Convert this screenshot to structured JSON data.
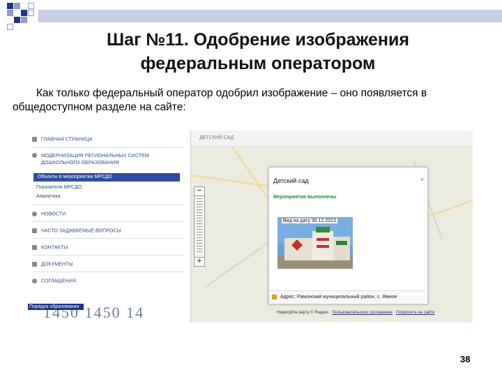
{
  "slide": {
    "title_line1": "Шаг №11. Одобрение изображения",
    "title_line2": "федеральным оператором",
    "intro": "Как только федеральный оператор одобрил изображение – оно появляется в общедоступном разделе на сайте:",
    "page_number": "38"
  },
  "screenshot": {
    "sidebar": {
      "items": [
        {
          "label": "Главная страница",
          "icon": "home-icon"
        },
        {
          "label": "Модернизация региональных систем дошкольного образования",
          "icon": "dot-icon"
        },
        {
          "label": "Новости",
          "icon": "dot-icon"
        },
        {
          "label": "Часто задаваемые вопросы",
          "icon": "chat-icon"
        },
        {
          "label": "Контакты",
          "icon": "phone-icon"
        },
        {
          "label": "Документы",
          "icon": "docs-icon"
        },
        {
          "label": "Соглашения",
          "icon": "dot-icon"
        }
      ],
      "subitems": [
        {
          "label": "Объекты в мероприятии МРСДО",
          "active": true
        },
        {
          "label": "Показатели МРСДО",
          "active": false
        },
        {
          "label": "Аналитика",
          "active": false
        }
      ],
      "bottom_link": "Порядок образования"
    },
    "breadcrumb": "ДЕТСКИЙ САД",
    "map": {
      "zoom_in": "+",
      "zoom_out": "−",
      "watermark": "1450   1450   14",
      "bottom_text": "Нарисуйте карту  © Яндекс",
      "bottom_link1": "Пользовательское соглашение",
      "bottom_link2": "Попросить на сайте"
    },
    "popup": {
      "title": "Детский сад",
      "close": "×",
      "status": "Мероприятия выполнены",
      "photo_caption": "Вид на дату 30.12.2013",
      "address": "Адрес: Рамонский муниципальный район, с. Ямное"
    }
  }
}
